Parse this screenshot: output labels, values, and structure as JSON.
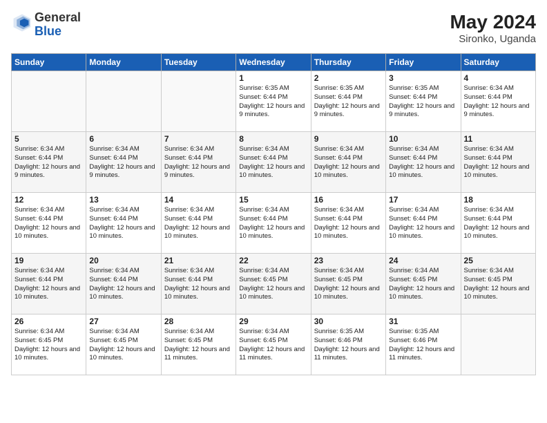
{
  "logo": {
    "general": "General",
    "blue": "Blue"
  },
  "title": {
    "month_year": "May 2024",
    "location": "Sironko, Uganda"
  },
  "weekdays": [
    "Sunday",
    "Monday",
    "Tuesday",
    "Wednesday",
    "Thursday",
    "Friday",
    "Saturday"
  ],
  "weeks": [
    [
      {
        "day": "",
        "sunrise": "",
        "sunset": "",
        "daylight": ""
      },
      {
        "day": "",
        "sunrise": "",
        "sunset": "",
        "daylight": ""
      },
      {
        "day": "",
        "sunrise": "",
        "sunset": "",
        "daylight": ""
      },
      {
        "day": "1",
        "sunrise": "Sunrise: 6:35 AM",
        "sunset": "Sunset: 6:44 PM",
        "daylight": "Daylight: 12 hours and 9 minutes."
      },
      {
        "day": "2",
        "sunrise": "Sunrise: 6:35 AM",
        "sunset": "Sunset: 6:44 PM",
        "daylight": "Daylight: 12 hours and 9 minutes."
      },
      {
        "day": "3",
        "sunrise": "Sunrise: 6:35 AM",
        "sunset": "Sunset: 6:44 PM",
        "daylight": "Daylight: 12 hours and 9 minutes."
      },
      {
        "day": "4",
        "sunrise": "Sunrise: 6:34 AM",
        "sunset": "Sunset: 6:44 PM",
        "daylight": "Daylight: 12 hours and 9 minutes."
      }
    ],
    [
      {
        "day": "5",
        "sunrise": "Sunrise: 6:34 AM",
        "sunset": "Sunset: 6:44 PM",
        "daylight": "Daylight: 12 hours and 9 minutes."
      },
      {
        "day": "6",
        "sunrise": "Sunrise: 6:34 AM",
        "sunset": "Sunset: 6:44 PM",
        "daylight": "Daylight: 12 hours and 9 minutes."
      },
      {
        "day": "7",
        "sunrise": "Sunrise: 6:34 AM",
        "sunset": "Sunset: 6:44 PM",
        "daylight": "Daylight: 12 hours and 9 minutes."
      },
      {
        "day": "8",
        "sunrise": "Sunrise: 6:34 AM",
        "sunset": "Sunset: 6:44 PM",
        "daylight": "Daylight: 12 hours and 10 minutes."
      },
      {
        "day": "9",
        "sunrise": "Sunrise: 6:34 AM",
        "sunset": "Sunset: 6:44 PM",
        "daylight": "Daylight: 12 hours and 10 minutes."
      },
      {
        "day": "10",
        "sunrise": "Sunrise: 6:34 AM",
        "sunset": "Sunset: 6:44 PM",
        "daylight": "Daylight: 12 hours and 10 minutes."
      },
      {
        "day": "11",
        "sunrise": "Sunrise: 6:34 AM",
        "sunset": "Sunset: 6:44 PM",
        "daylight": "Daylight: 12 hours and 10 minutes."
      }
    ],
    [
      {
        "day": "12",
        "sunrise": "Sunrise: 6:34 AM",
        "sunset": "Sunset: 6:44 PM",
        "daylight": "Daylight: 12 hours and 10 minutes."
      },
      {
        "day": "13",
        "sunrise": "Sunrise: 6:34 AM",
        "sunset": "Sunset: 6:44 PM",
        "daylight": "Daylight: 12 hours and 10 minutes."
      },
      {
        "day": "14",
        "sunrise": "Sunrise: 6:34 AM",
        "sunset": "Sunset: 6:44 PM",
        "daylight": "Daylight: 12 hours and 10 minutes."
      },
      {
        "day": "15",
        "sunrise": "Sunrise: 6:34 AM",
        "sunset": "Sunset: 6:44 PM",
        "daylight": "Daylight: 12 hours and 10 minutes."
      },
      {
        "day": "16",
        "sunrise": "Sunrise: 6:34 AM",
        "sunset": "Sunset: 6:44 PM",
        "daylight": "Daylight: 12 hours and 10 minutes."
      },
      {
        "day": "17",
        "sunrise": "Sunrise: 6:34 AM",
        "sunset": "Sunset: 6:44 PM",
        "daylight": "Daylight: 12 hours and 10 minutes."
      },
      {
        "day": "18",
        "sunrise": "Sunrise: 6:34 AM",
        "sunset": "Sunset: 6:44 PM",
        "daylight": "Daylight: 12 hours and 10 minutes."
      }
    ],
    [
      {
        "day": "19",
        "sunrise": "Sunrise: 6:34 AM",
        "sunset": "Sunset: 6:44 PM",
        "daylight": "Daylight: 12 hours and 10 minutes."
      },
      {
        "day": "20",
        "sunrise": "Sunrise: 6:34 AM",
        "sunset": "Sunset: 6:44 PM",
        "daylight": "Daylight: 12 hours and 10 minutes."
      },
      {
        "day": "21",
        "sunrise": "Sunrise: 6:34 AM",
        "sunset": "Sunset: 6:44 PM",
        "daylight": "Daylight: 12 hours and 10 minutes."
      },
      {
        "day": "22",
        "sunrise": "Sunrise: 6:34 AM",
        "sunset": "Sunset: 6:45 PM",
        "daylight": "Daylight: 12 hours and 10 minutes."
      },
      {
        "day": "23",
        "sunrise": "Sunrise: 6:34 AM",
        "sunset": "Sunset: 6:45 PM",
        "daylight": "Daylight: 12 hours and 10 minutes."
      },
      {
        "day": "24",
        "sunrise": "Sunrise: 6:34 AM",
        "sunset": "Sunset: 6:45 PM",
        "daylight": "Daylight: 12 hours and 10 minutes."
      },
      {
        "day": "25",
        "sunrise": "Sunrise: 6:34 AM",
        "sunset": "Sunset: 6:45 PM",
        "daylight": "Daylight: 12 hours and 10 minutes."
      }
    ],
    [
      {
        "day": "26",
        "sunrise": "Sunrise: 6:34 AM",
        "sunset": "Sunset: 6:45 PM",
        "daylight": "Daylight: 12 hours and 10 minutes."
      },
      {
        "day": "27",
        "sunrise": "Sunrise: 6:34 AM",
        "sunset": "Sunset: 6:45 PM",
        "daylight": "Daylight: 12 hours and 10 minutes."
      },
      {
        "day": "28",
        "sunrise": "Sunrise: 6:34 AM",
        "sunset": "Sunset: 6:45 PM",
        "daylight": "Daylight: 12 hours and 11 minutes."
      },
      {
        "day": "29",
        "sunrise": "Sunrise: 6:34 AM",
        "sunset": "Sunset: 6:45 PM",
        "daylight": "Daylight: 12 hours and 11 minutes."
      },
      {
        "day": "30",
        "sunrise": "Sunrise: 6:35 AM",
        "sunset": "Sunset: 6:46 PM",
        "daylight": "Daylight: 12 hours and 11 minutes."
      },
      {
        "day": "31",
        "sunrise": "Sunrise: 6:35 AM",
        "sunset": "Sunset: 6:46 PM",
        "daylight": "Daylight: 12 hours and 11 minutes."
      },
      {
        "day": "",
        "sunrise": "",
        "sunset": "",
        "daylight": ""
      }
    ]
  ]
}
